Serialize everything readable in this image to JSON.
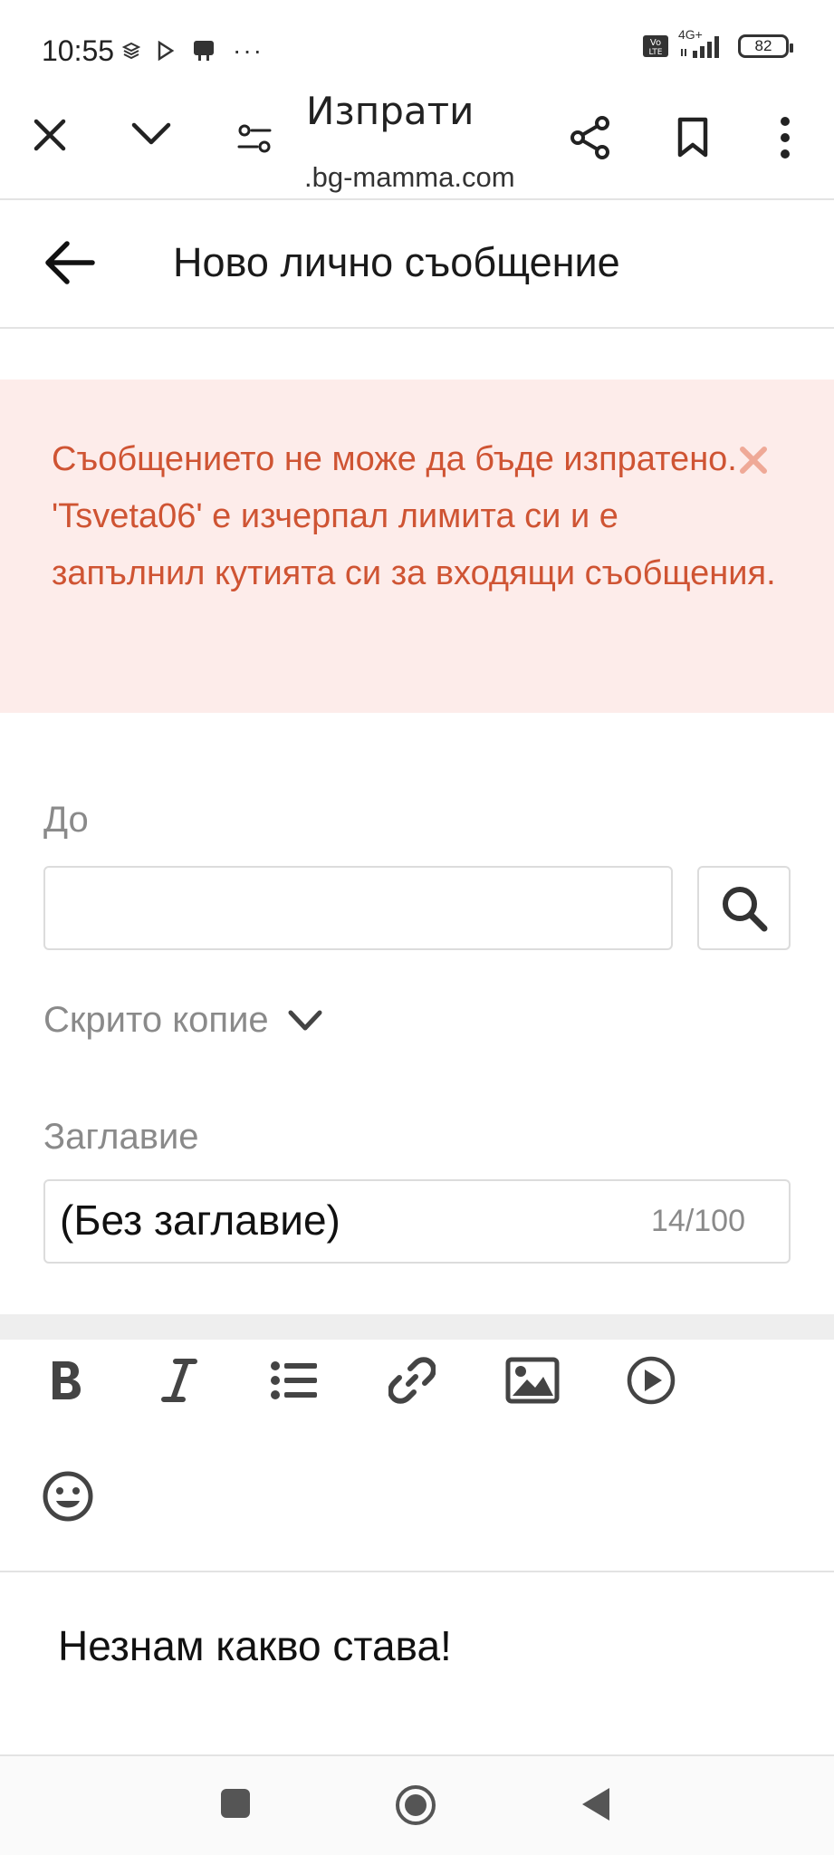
{
  "status_bar": {
    "time": "10:55",
    "more": "···",
    "network": "4G+",
    "volte": "Vo LTE",
    "battery": "82"
  },
  "browser": {
    "title": "Изпрати",
    "url": ".bg-mamma.com"
  },
  "header": {
    "title": "Ново лично съобщение"
  },
  "alert": {
    "message": "Съобщението не може да бъде изпратено. 'Tsveta06' е изчерпал лимита си и е запълнил кутията си за входящи съобщения.",
    "color": "#cf5433",
    "background": "#fdecea"
  },
  "form": {
    "to_label": "До",
    "to_value": "",
    "bcc_label": "Скрито копие",
    "subject_label": "Заглавие",
    "subject_value": "(Без заглавие)",
    "subject_counter": "14/100"
  },
  "editor": {
    "tools": [
      "bold-icon",
      "italic-icon",
      "list-icon",
      "link-icon",
      "image-icon",
      "video-icon",
      "emoji-icon"
    ],
    "content": "Незнам какво става!"
  }
}
